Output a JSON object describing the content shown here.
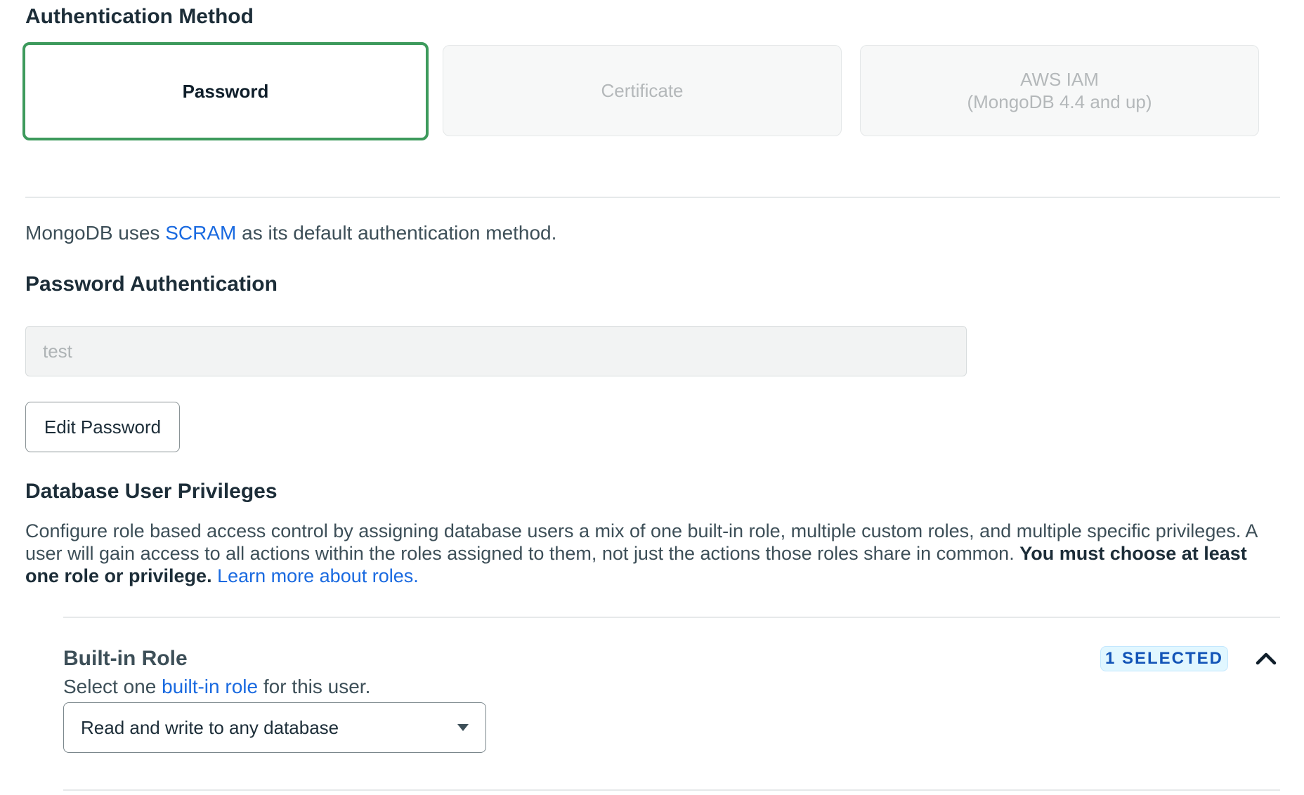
{
  "auth_method": {
    "heading": "Authentication Method",
    "options": [
      {
        "label": "Password",
        "selected": true
      },
      {
        "label": "Certificate",
        "selected": false
      },
      {
        "label_line1": "AWS IAM",
        "label_line2": "(MongoDB 4.4 and up)",
        "selected": false
      }
    ]
  },
  "scram": {
    "prefix": "MongoDB uses ",
    "link": "SCRAM",
    "suffix": " as its default authentication method."
  },
  "password_auth": {
    "heading": "Password Authentication",
    "username_value": "test",
    "edit_button": "Edit Password"
  },
  "privileges": {
    "heading": "Database User Privileges",
    "description": "Configure role based access control by assigning database users a mix of one built-in role, multiple custom roles, and multiple specific privileges. A user will gain access to all actions within the roles assigned to them, not just the actions those roles share in common. ",
    "bold_text": "You must choose at least one role or privilege.",
    "link": "Learn more about roles."
  },
  "builtin_role": {
    "heading": "Built-in Role",
    "badge": "1 SELECTED",
    "desc_prefix": "Select one ",
    "desc_link": "built-in role",
    "desc_suffix": " for this user.",
    "selected_value": "Read and write to any database"
  },
  "colors": {
    "selected_border": "#3d9a5c",
    "link": "#1a6ae0",
    "badge_bg": "#e1f7ff",
    "badge_text": "#1254b7"
  },
  "icons": {
    "collapse": "chevron-up-icon",
    "dropdown": "caret-down-icon"
  }
}
